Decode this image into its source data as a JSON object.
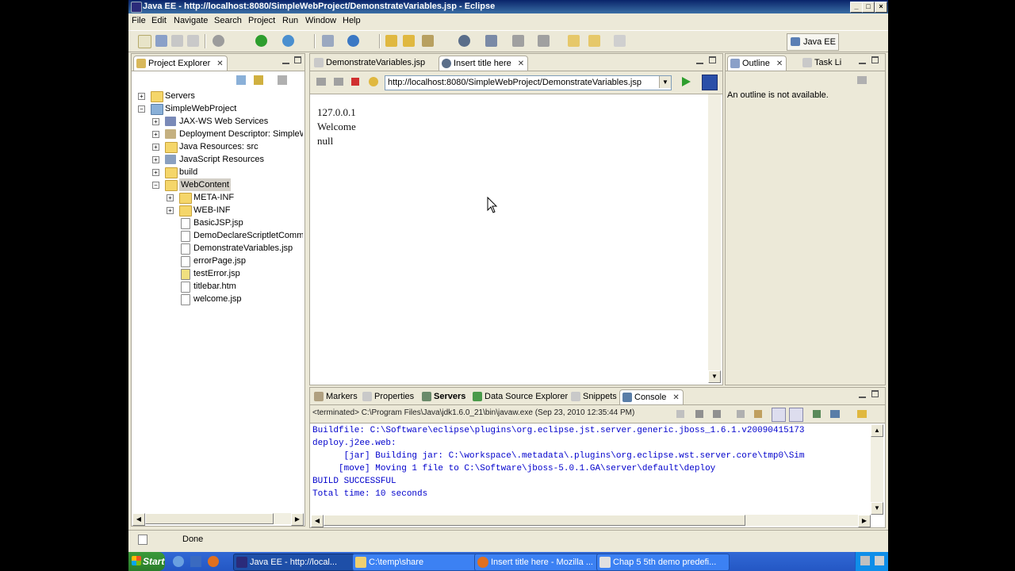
{
  "window": {
    "title": "Java EE - http://localhost:8080/SimpleWebProject/DemonstrateVariables.jsp - Eclipse"
  },
  "menu": [
    "File",
    "Edit",
    "Navigate",
    "Search",
    "Project",
    "Run",
    "Window",
    "Help"
  ],
  "perspective": {
    "label": "Java EE"
  },
  "project_explorer": {
    "tab": "Project Explorer",
    "tree": [
      {
        "label": "Servers"
      },
      {
        "label": "SimpleWebProject"
      },
      {
        "label": "JAX-WS Web Services"
      },
      {
        "label": "Deployment Descriptor: SimpleWebP"
      },
      {
        "label": "Java Resources: src"
      },
      {
        "label": "JavaScript Resources"
      },
      {
        "label": "build"
      },
      {
        "label": "WebContent"
      },
      {
        "label": "META-INF"
      },
      {
        "label": "WEB-INF"
      },
      {
        "label": "BasicJSP.jsp"
      },
      {
        "label": "DemoDeclareScriptletComments"
      },
      {
        "label": "DemonstrateVariables.jsp"
      },
      {
        "label": "errorPage.jsp"
      },
      {
        "label": "testError.jsp"
      },
      {
        "label": "titlebar.htm"
      },
      {
        "label": "welcome.jsp"
      }
    ]
  },
  "editor": {
    "tabs": [
      "DemonstrateVariables.jsp",
      "Insert title here"
    ],
    "url": "http://localhost:8080/SimpleWebProject/DemonstrateVariables.jsp",
    "content": [
      "127.0.0.1",
      "Welcome",
      "null"
    ]
  },
  "outline": {
    "tab": "Outline",
    "tab2": "Task Li",
    "message": "An outline is not available."
  },
  "bottom": {
    "tabs": [
      "Markers",
      "Properties",
      "Servers",
      "Data Source Explorer",
      "Snippets",
      "Console"
    ],
    "console_header": "<terminated> C:\\Program Files\\Java\\jdk1.6.0_21\\bin\\javaw.exe (Sep 23, 2010 12:35:44 PM)",
    "lines": [
      "Buildfile: C:\\Software\\eclipse\\plugins\\org.eclipse.jst.server.generic.jboss_1.6.1.v20090415173",
      "deploy.j2ee.web:",
      "      [jar] Building jar: C:\\workspace\\.metadata\\.plugins\\org.eclipse.wst.server.core\\tmp0\\Sim",
      "     [move] Moving 1 file to C:\\Software\\jboss-5.0.1.GA\\server\\default\\deploy",
      "BUILD SUCCESSFUL",
      "Total time: 10 seconds"
    ]
  },
  "status": {
    "text": "Done"
  },
  "taskbar": {
    "start": "Start",
    "items": [
      "Java EE - http://local...",
      "C:\\temp\\share",
      "Insert title here - Mozilla ...",
      "Chap 5 5th demo predefi..."
    ]
  },
  "colors": {
    "titlebar": "#0a246a",
    "taskbar": "#2457c4",
    "console_text": "#0000cc",
    "selection": "#d4d0c8"
  }
}
